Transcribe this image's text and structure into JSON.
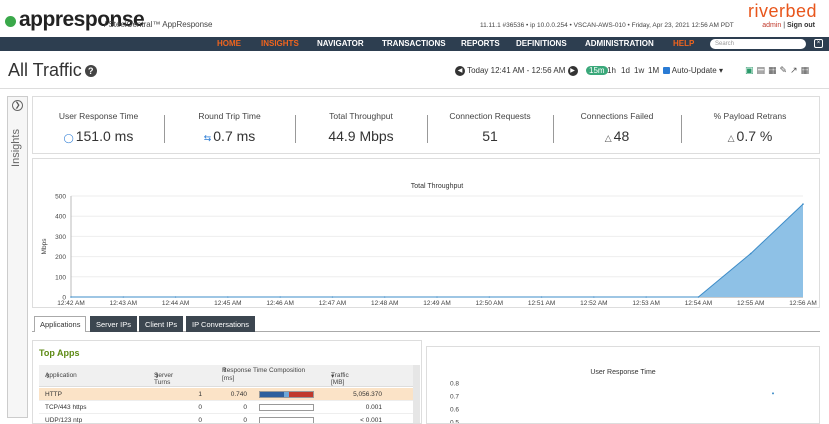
{
  "header": {
    "product_name": "appresponse",
    "product_sub": "/ SteelCentral™ AppResponse",
    "system_info": "11.11.1 #36536 • ip 10.0.0.254 • VSCAN-AWS-010 • Friday, Apr 23, 2021 12:56 AM PDT",
    "brand": "riverbed",
    "user": "admin",
    "separator": "|",
    "signout": "Sign out"
  },
  "nav": {
    "items": [
      "HOME",
      "INSIGHTS",
      "NAVIGATOR",
      "TRANSACTIONS",
      "REPORTS",
      "DEFINITIONS",
      "ADMINISTRATION",
      "HELP"
    ],
    "search_placeholder": "Search"
  },
  "titlebar": {
    "title": "All Traffic",
    "time_range": "Today 12:41 AM - 12:56 AM",
    "ranges": [
      "15m",
      "1h",
      "1d",
      "1w",
      "1M"
    ],
    "active_range": "15m",
    "auto_update_label": "Auto-Update",
    "auto_update_checked": true
  },
  "sidebar": {
    "label": "Insights"
  },
  "metrics": [
    {
      "label": "User Response Time",
      "value": "151.0 ms",
      "icon": "drop-icon"
    },
    {
      "label": "Round Trip Time",
      "value": "0.7 ms",
      "icon": "arrows-icon"
    },
    {
      "label": "Total Throughput",
      "value": "44.9 Mbps",
      "icon": ""
    },
    {
      "label": "Connection Requests",
      "value": "51",
      "icon": ""
    },
    {
      "label": "Connections Failed",
      "value": "48",
      "icon": "warning-icon"
    },
    {
      "label": "% Payload Retrans",
      "value": "0.7 %",
      "icon": "warning-icon"
    }
  ],
  "chart_data": [
    {
      "type": "area",
      "title": "Total Throughput",
      "xlabel": "",
      "ylabel": "Mbps",
      "ylim": [
        0,
        500
      ],
      "yticks": [
        0,
        100,
        200,
        300,
        400,
        500
      ],
      "categories": [
        "12:42 AM",
        "12:43 AM",
        "12:44 AM",
        "12:45 AM",
        "12:46 AM",
        "12:47 AM",
        "12:48 AM",
        "12:49 AM",
        "12:50 AM",
        "12:51 AM",
        "12:52 AM",
        "12:53 AM",
        "12:54 AM",
        "12:55 AM",
        "12:56 AM"
      ],
      "x": [
        "12:42 AM",
        "12:43 AM",
        "12:44 AM",
        "12:45 AM",
        "12:46 AM",
        "12:47 AM",
        "12:48 AM",
        "12:49 AM",
        "12:50 AM",
        "12:51 AM",
        "12:52 AM",
        "12:53 AM",
        "12:54 AM",
        "12:55 AM",
        "12:56 AM"
      ],
      "values": [
        0,
        0,
        0,
        0,
        0,
        0,
        0,
        0,
        0,
        0,
        0,
        0,
        0,
        215,
        460
      ],
      "color": "#8ec1e6",
      "line_color": "#3d8cc8"
    },
    {
      "type": "scatter",
      "title": "User Response Time",
      "ylim": [
        0.5,
        0.8
      ],
      "yticks": [
        0.5,
        0.6,
        0.7,
        0.8
      ],
      "points": [
        {
          "x": 0.9,
          "y": 0.72
        }
      ]
    }
  ],
  "tabs": [
    "Applications",
    "Server IPs",
    "Client IPs",
    "IP Conversations"
  ],
  "active_tab": "Applications",
  "top_apps": {
    "title": "Top Apps",
    "columns": [
      "Application",
      "Server Turns",
      "Response Time Composition [ms]",
      "Traffic [MB]"
    ],
    "rows": [
      {
        "app": "HTTP",
        "turns": "1",
        "rt": "0.740",
        "traffic": "5,056.370",
        "highlight": true,
        "segments": [
          0.45,
          0.1,
          0.45
        ]
      },
      {
        "app": "TCP/443 https",
        "turns": "0",
        "rt": "0",
        "traffic": "0.001",
        "highlight": false,
        "segments": []
      },
      {
        "app": "UDP/123 ntp",
        "turns": "0",
        "rt": "0",
        "traffic": "< 0.001",
        "highlight": false,
        "segments": []
      }
    ],
    "segment_colors": [
      "#2e5f9e",
      "#6fa8d8",
      "#c0392b"
    ]
  }
}
